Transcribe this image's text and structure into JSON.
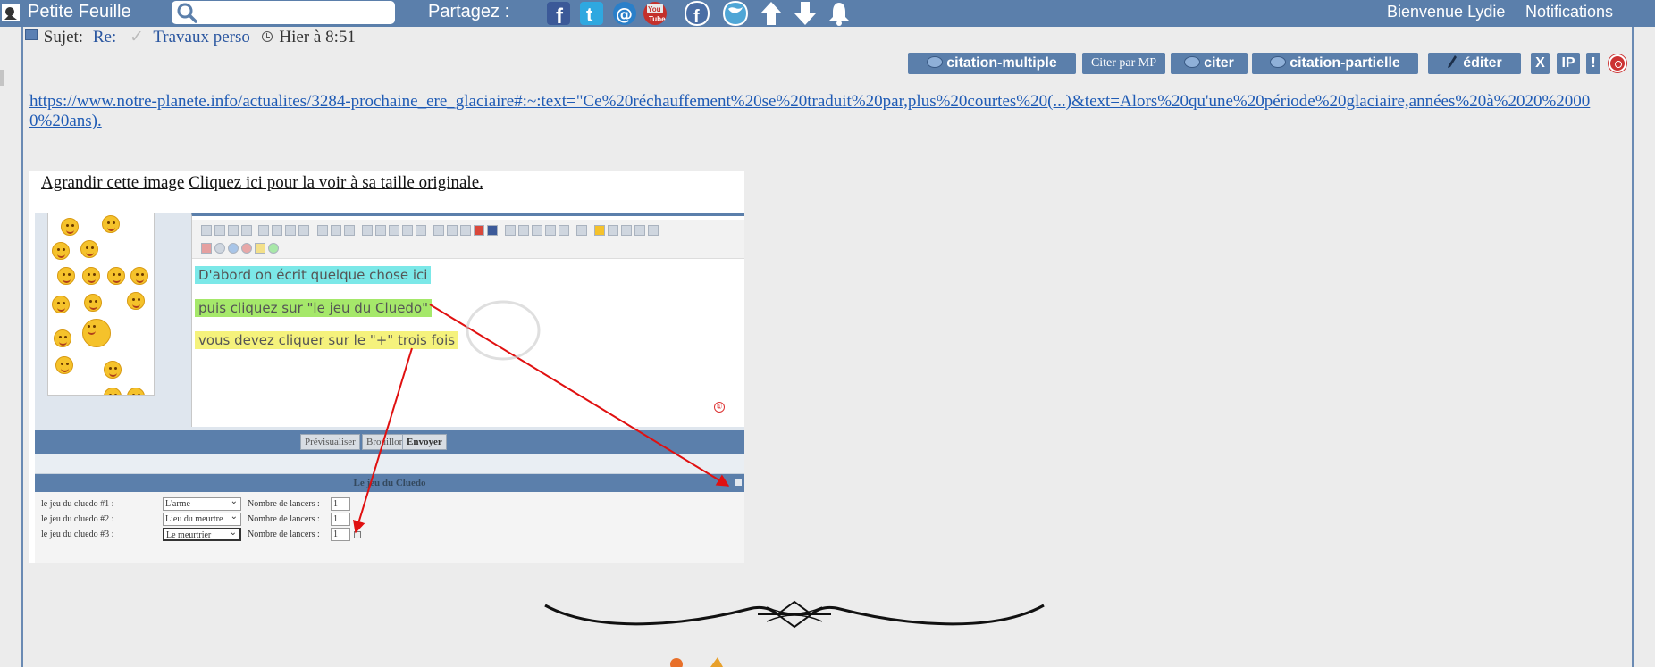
{
  "topbar": {
    "site_title": "Petite Feuille",
    "search_placeholder": "",
    "share_label": "Partagez :",
    "share_icons": [
      "facebook-icon",
      "twitter-icon",
      "email-icon",
      "youtube-icon",
      "facebook-icon",
      "twitter-icon",
      "arrow-up-icon",
      "arrow-down-icon",
      "bell-icon"
    ],
    "welcome": "Bienvenue Lydie",
    "notifications": "Notifications",
    "bar_color": "#5b7fab"
  },
  "post": {
    "subject_label": "Sujet:",
    "re_label": "Re:",
    "topic": "Travaux perso",
    "time": "Hier à 8:51",
    "link": "https://www.notre-planete.info/actualites/3284-prochaine_ere_glaciaire#:~:text=\"Ce%20réchauffement%20se%20traduit%20par,plus%20courtes%20(...)&text=Alors%20qu'une%20période%20glaciaire,années%20à%2020%20000%20ans)."
  },
  "actions": {
    "citation_multiple": "citation-multiple",
    "citer_mp": "Citer par MP",
    "citer": "citer",
    "citation_partielle": "citation-partielle",
    "editer": "éditer",
    "delete": "X",
    "ip": "IP",
    "report": "!"
  },
  "image": {
    "enlarge": "Agrandir cette image",
    "original": "Cliquez ici pour la voir à sa taille originale.",
    "editor_lines": [
      "D'abord on écrit quelque chose ici",
      "puis cliquez sur \"le jeu du Cluedo\"",
      "vous devez cliquer sur le \"+\" trois fois"
    ],
    "char_count": "①",
    "buttons": [
      "Prévisualiser",
      "Brouillon",
      "Envoyer"
    ],
    "cluedo_title": "Le jeu du Cluedo",
    "cluedo_rows": [
      {
        "label": "le jeu du cluedo #1 :",
        "select": "L'arme",
        "count_label": "Nombre de lancers :",
        "count": "1"
      },
      {
        "label": "le jeu du cluedo #2 :",
        "select": "Lieu du meurtre",
        "count_label": "Nombre de lancers :",
        "count": "1"
      },
      {
        "label": "le jeu du cluedo #3 :",
        "select": "Le meurtrier",
        "count_label": "Nombre de lancers :",
        "count": "1"
      }
    ],
    "annotation_color": "#e01010"
  }
}
